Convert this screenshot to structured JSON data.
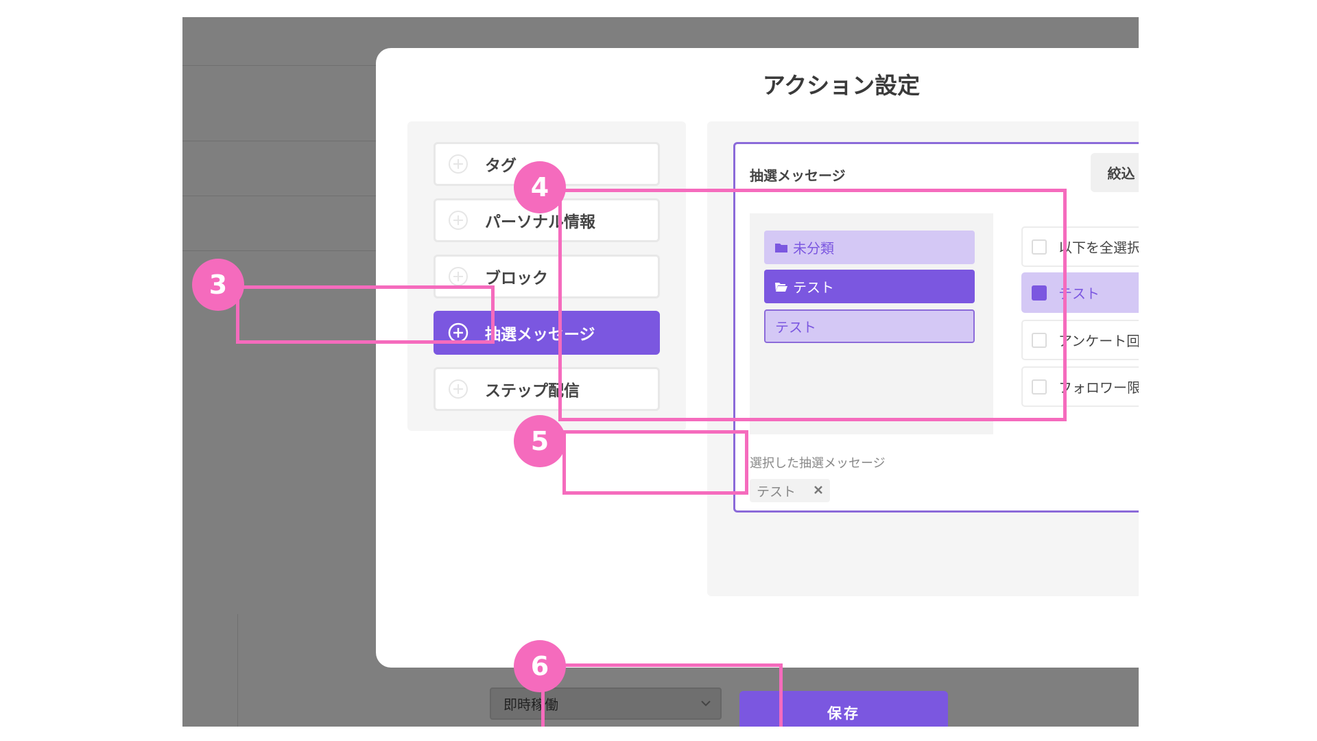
{
  "modal": {
    "title": "アクション設定"
  },
  "sidebar": {
    "items": [
      {
        "label": "タグ"
      },
      {
        "label": "パーソナル情報"
      },
      {
        "label": "ブロック"
      },
      {
        "label": "抽選メッセージ",
        "active": true
      },
      {
        "label": "ステップ配信"
      }
    ]
  },
  "card": {
    "title": "抽選メッセージ",
    "filter_label": "絞込 未設定",
    "folders": [
      {
        "label": "未分類"
      },
      {
        "label": "テスト",
        "active": true
      },
      {
        "label": "テスト"
      }
    ],
    "options": [
      {
        "label": "以下を全選択",
        "checked": false
      },
      {
        "label": "テスト",
        "checked": true
      },
      {
        "label": "アンケート回答者限定",
        "checked": false
      },
      {
        "label": "フォロワー限定",
        "checked": false
      }
    ],
    "selected_label": "選択した抽選メッセージ",
    "selected_chips": [
      {
        "label": "テスト"
      }
    ]
  },
  "footer": {
    "save_label": "保存",
    "select_value": "即時稼働"
  },
  "annotations": [
    "3",
    "4",
    "5",
    "6"
  ],
  "colors": {
    "accent": "#7b57e0",
    "accent_light": "#d4c8f5",
    "highlight": "#f56bbd"
  }
}
